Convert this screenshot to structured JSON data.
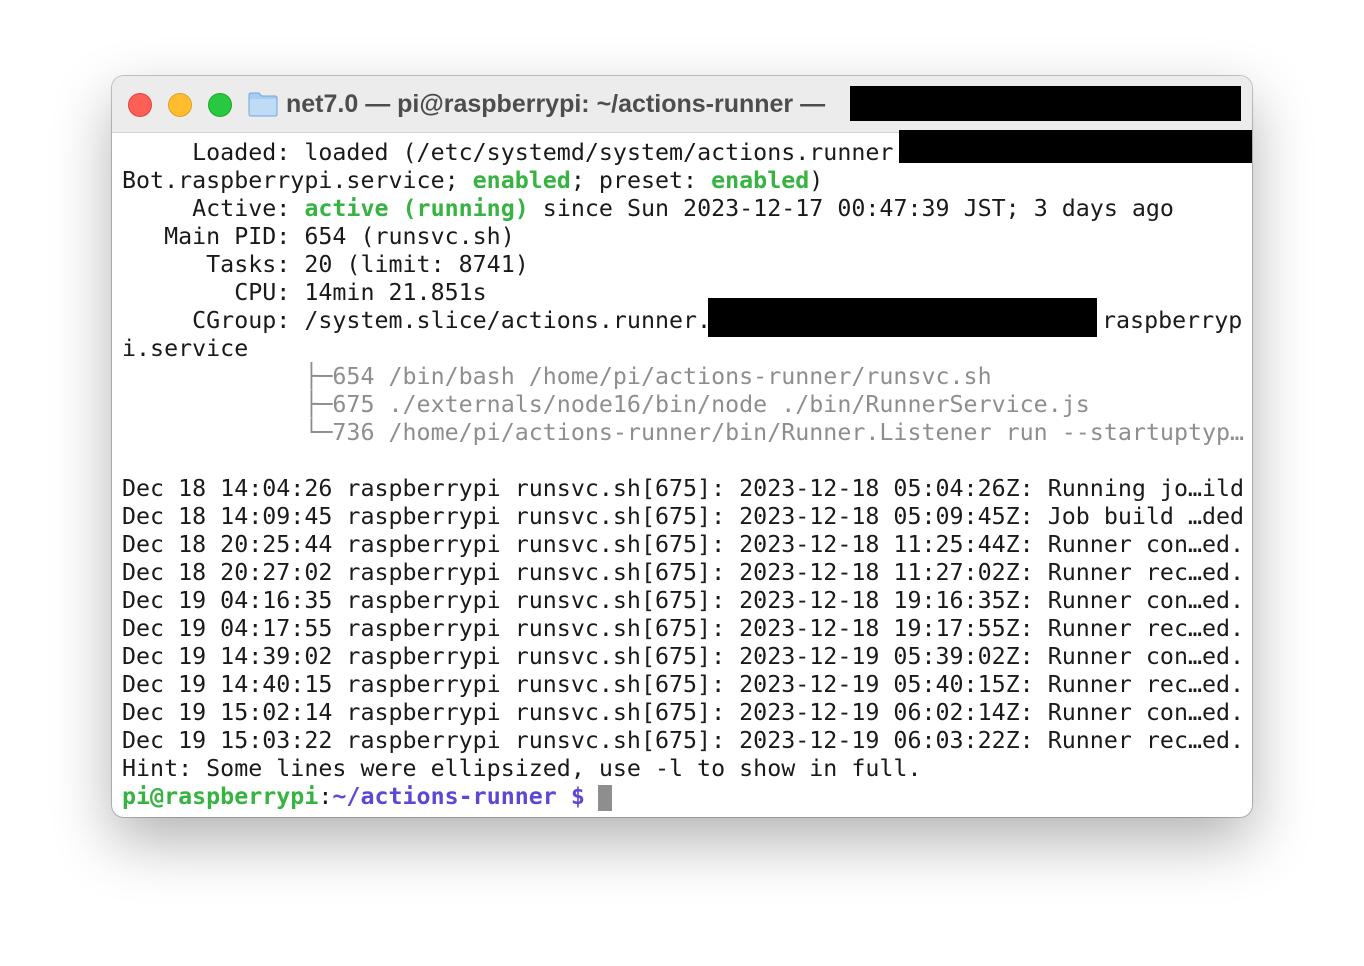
{
  "window": {
    "title": "net7.0 — pi@raspberrypi: ~/actions-runner —",
    "controls": {
      "close": "close",
      "minimize": "minimize",
      "zoom": "zoom"
    },
    "folder_icon": "folder-icon"
  },
  "status": {
    "loaded_label": "     Loaded: ",
    "loaded_value": "loaded (/etc/systemd/system/actions.runner.",
    "loaded_cont_prefix": "Bot.raspberrypi.service; ",
    "enabled1": "enabled",
    "preset_text": "; preset: ",
    "enabled2": "enabled",
    "close_paren": ")",
    "active_label": "     Active: ",
    "active_value": "active (running)",
    "active_since": " since Sun 2023-12-17 00:47:39 JST; 3 days ago",
    "main_pid": "   Main PID: 654 (runsvc.sh)",
    "tasks": "      Tasks: 20 (limit: 8741)",
    "cpu": "        CPU: 14min 21.851s",
    "cgroup_prefix": "     CGroup: /system.slice/actions.runner.",
    "cgroup_suffix": "raspberryp",
    "cgroup_cont": "i.service",
    "tree": [
      "             ├─654 /bin/bash /home/pi/actions-runner/runsvc.sh",
      "             ├─675 ./externals/node16/bin/node ./bin/RunnerService.js",
      "             └─736 /home/pi/actions-runner/bin/Runner.Listener run --startuptyp…"
    ]
  },
  "log_lines": [
    "Dec 18 14:04:26 raspberrypi runsvc.sh[675]: 2023-12-18 05:04:26Z: Running jo…ild",
    "Dec 18 14:09:45 raspberrypi runsvc.sh[675]: 2023-12-18 05:09:45Z: Job build …ded",
    "Dec 18 20:25:44 raspberrypi runsvc.sh[675]: 2023-12-18 11:25:44Z: Runner con…ed.",
    "Dec 18 20:27:02 raspberrypi runsvc.sh[675]: 2023-12-18 11:27:02Z: Runner rec…ed.",
    "Dec 19 04:16:35 raspberrypi runsvc.sh[675]: 2023-12-18 19:16:35Z: Runner con…ed.",
    "Dec 19 04:17:55 raspberrypi runsvc.sh[675]: 2023-12-18 19:17:55Z: Runner rec…ed.",
    "Dec 19 14:39:02 raspberrypi runsvc.sh[675]: 2023-12-19 05:39:02Z: Runner con…ed.",
    "Dec 19 14:40:15 raspberrypi runsvc.sh[675]: 2023-12-19 05:40:15Z: Runner rec…ed.",
    "Dec 19 15:02:14 raspberrypi runsvc.sh[675]: 2023-12-19 06:02:14Z: Runner con…ed.",
    "Dec 19 15:03:22 raspberrypi runsvc.sh[675]: 2023-12-19 06:03:22Z: Runner rec…ed."
  ],
  "hint": "Hint: Some lines were ellipsized, use -l to show in full.",
  "prompt": {
    "user_host": "pi@raspberrypi",
    "colon": ":",
    "path": "~/actions-runner $",
    "space": " "
  },
  "colors": {
    "green": "#36b341",
    "prompt_path": "#5b49d6",
    "tree_gray": "#8e8e8e",
    "close": "#fe5f57",
    "minimize": "#febc2e",
    "zoom": "#28c840"
  }
}
